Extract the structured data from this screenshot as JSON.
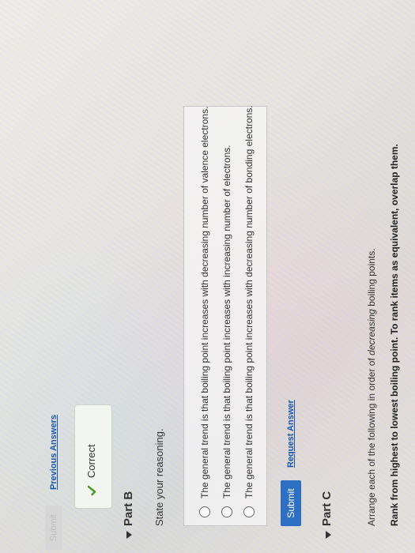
{
  "top": {
    "submit_disabled_label": "Submit",
    "previous_answers_link": "Previous Answers"
  },
  "feedback": {
    "status": "Correct"
  },
  "part_b": {
    "title": "Part B",
    "prompt": "State your reasoning.",
    "options": [
      {
        "label": "The general trend is that boiling point increases with decreasing number of valence electrons."
      },
      {
        "label": "The general trend is that boiling point increases with increasing number of electrons."
      },
      {
        "label": "The general trend is that boiling point increases with decreasing number of bonding electrons."
      }
    ],
    "submit_label": "Submit",
    "request_answer_link": "Request Answer"
  },
  "part_c": {
    "title": "Part C",
    "arrange_prefix": "Arrange each of the following in order of ",
    "arrange_emphasis": "decreasing",
    "arrange_suffix": " boiling points.",
    "rank_instruction": "Rank from highest to lowest boiling point. To rank items as equivalent, overlap them."
  },
  "colors": {
    "primary_button": "#2d6fc2",
    "link": "#1a58b0",
    "check": "#4a9a2e"
  },
  "icons": {
    "check": "checkmark-icon",
    "expand": "triangle-down-icon",
    "radio": "radio-unselected-icon"
  }
}
